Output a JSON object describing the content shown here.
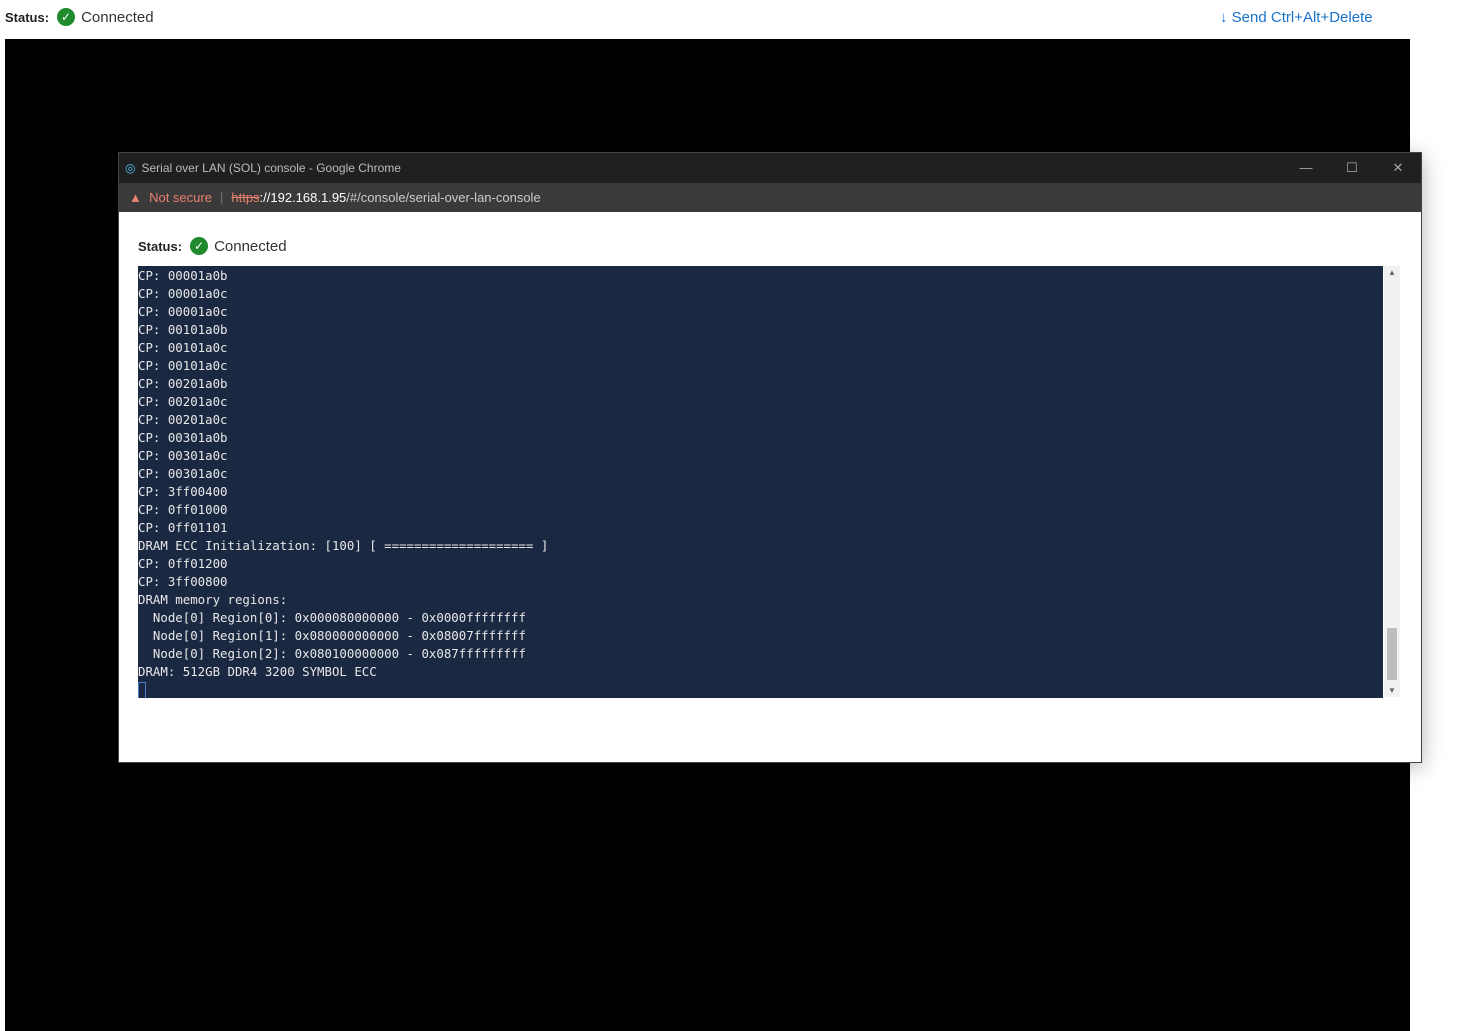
{
  "page": {
    "status_label": "Status:",
    "status_value": "Connected",
    "send_cad": "Send Ctrl+Alt+Delete"
  },
  "popup": {
    "title": "Serial over LAN (SOL) console - Google Chrome",
    "not_secure": "Not secure",
    "url_scheme": "https",
    "url_host": "://192.168.1.95",
    "url_path": "/#/console/serial-over-lan-console",
    "status_label": "Status:",
    "status_value": "Connected"
  },
  "terminal": {
    "lines": [
      "CP: 00001a0b",
      "CP: 00001a0c",
      "CP: 00001a0c",
      "CP: 00101a0b",
      "CP: 00101a0c",
      "CP: 00101a0c",
      "CP: 00201a0b",
      "CP: 00201a0c",
      "CP: 00201a0c",
      "CP: 00301a0b",
      "CP: 00301a0c",
      "CP: 00301a0c",
      "CP: 3ff00400",
      "CP: 0ff01000",
      "CP: 0ff01101",
      "DRAM ECC Initialization: [100] [ ==================== ]",
      "CP: 0ff01200",
      "CP: 3ff00800",
      "DRAM memory regions:",
      "  Node[0] Region[0]: 0x000080000000 - 0x0000ffffffff",
      "  Node[0] Region[1]: 0x080000000000 - 0x08007fffffff",
      "  Node[0] Region[2]: 0x080100000000 - 0x087fffffffff",
      "DRAM: 512GB DDR4 3200 SYMBOL ECC"
    ]
  }
}
